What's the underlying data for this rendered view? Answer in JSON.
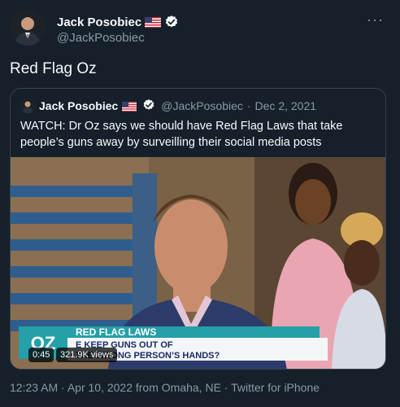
{
  "author": {
    "name": "Jack Posobiec",
    "handle": "@JackPosobiec",
    "flag": "us-flag-emoji",
    "verified_icon": "verified-badge"
  },
  "more_menu": "···",
  "tweet": {
    "text": "Red Flag Oz"
  },
  "quote": {
    "name": "Jack Posobiec",
    "handle": "@JackPosobiec",
    "date": "Dec 2, 2021",
    "text": "WATCH: Dr Oz says we should have Red Flag Laws that take people’s guns away by surveilling their social media posts",
    "video": {
      "duration": "0:45",
      "views": "321.9K views",
      "chyron_title": "RED FLAG LAWS",
      "chyron_line1": "KEEP GUNS OUT OF",
      "chyron_line2": "THE WRONG PERSON’S HANDS?",
      "chyron_fragment": "E",
      "show_logo": "OZ"
    }
  },
  "meta": {
    "timestamp": "12:23 AM · Apr 10, 2022 from Omaha, NE · Twitter for iPhone"
  },
  "colors": {
    "background": "#15202b",
    "text": "#f7f9f9",
    "secondary": "#8b98a5",
    "border": "#38444d",
    "verified": "#1d9bf0",
    "chyron_teal": "#25a0a8",
    "chyron_navy": "#1b2a66"
  }
}
